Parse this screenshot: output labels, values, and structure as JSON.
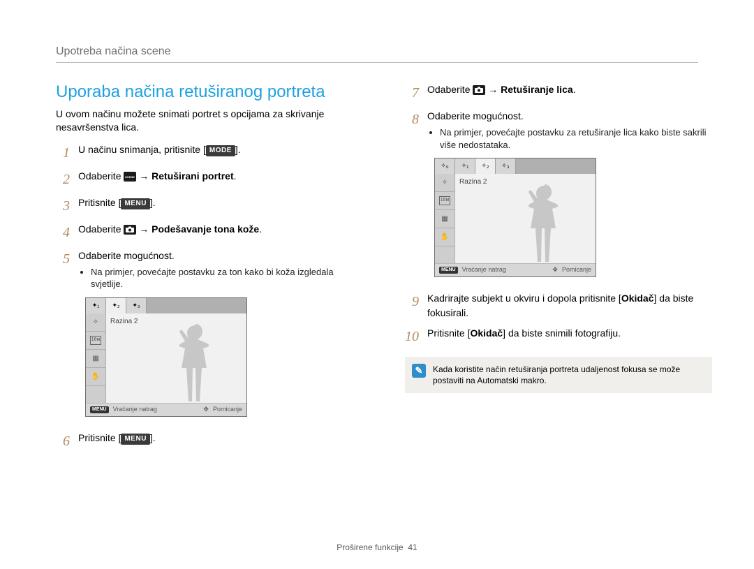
{
  "header": {
    "breadcrumb": "Upotreba načina scene"
  },
  "section": {
    "title": "Uporaba načina retuširanog portreta",
    "intro": "U ovom načinu možete snimati portret s opcijama za skrivanje nesavršenstva lica."
  },
  "steps": {
    "s1_a": "U načinu snimanja, pritisnite [",
    "s1_mode": "MODE",
    "s1_b": "].",
    "s2_a": "Odaberite ",
    "s2_b": " → ",
    "s2_c": "Retuširani portret",
    "s2_d": ".",
    "s3_a": "Pritisnite [",
    "s3_menu": "MENU",
    "s3_b": "].",
    "s4_a": "Odaberite ",
    "s4_b": " → ",
    "s4_c": "Podešavanje tona kože",
    "s4_d": ".",
    "s5": "Odaberite mogućnost.",
    "s5_note": "Na primjer, povećajte postavku za ton kako bi koža izgledala svjetlije.",
    "s6_a": "Pritisnite [",
    "s6_menu": "MENU",
    "s6_b": "].",
    "s7_a": "Odaberite ",
    "s7_b": " → ",
    "s7_c": "Retuširanje lica",
    "s7_d": ".",
    "s8": "Odaberite mogućnost.",
    "s8_note": "Na primjer, povećajte postavku za retuširanje lica kako biste sakrili više nedostataka.",
    "s9_a": "Kadrirajte subjekt u okviru i dopola pritisnite [",
    "s9_b": "Okidač",
    "s9_c": "] da biste fokusirali.",
    "s10_a": "Pritisnite [",
    "s10_b": "Okidač",
    "s10_c": "] da biste snimili fotografiju."
  },
  "screenshot": {
    "level": "Razina 2",
    "back_key": "MENU",
    "back": "Vraćanje natrag",
    "move": "Pomicanje"
  },
  "note": "Kada koristite način retuširanja portreta udaljenost fokusa se može postaviti na Automatski makro.",
  "footer": {
    "section": "Proširene funkcije",
    "page": "41"
  }
}
